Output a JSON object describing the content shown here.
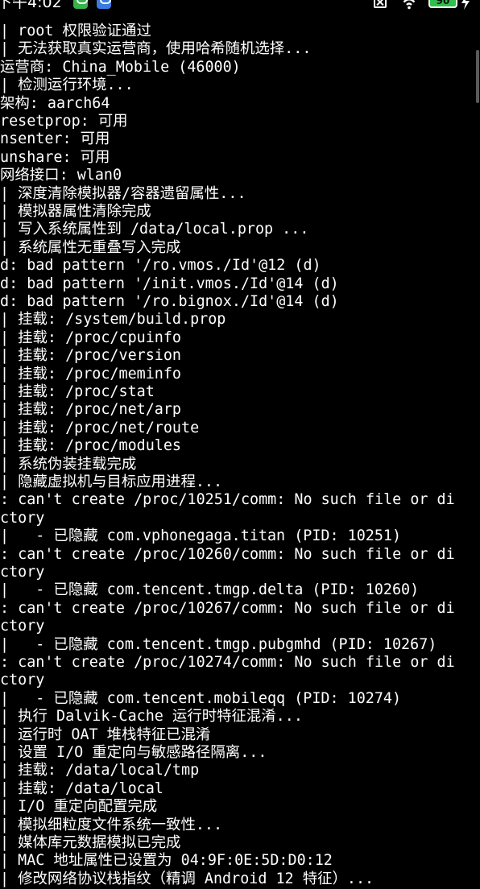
{
  "status_bar": {
    "time": "下午4:02",
    "battery_level": "90",
    "icons": [
      "app-notification-icon",
      "app-notification-icon",
      "sim-off-icon",
      "wifi-icon",
      "battery-icon",
      "charging-bolt-icon"
    ]
  },
  "terminal": {
    "lines": [
      "| root 权限验证通过",
      "| 无法获取真实运营商，使用哈希随机选择...",
      "运营商: China_Mobile (46000)",
      "| 检测运行环境...",
      "架构: aarch64",
      "resetprop: 可用",
      "nsenter: 可用",
      "unshare: 可用",
      "网络接口: wlan0",
      "| 深度清除模拟器/容器遗留属性...",
      "| 模拟器属性清除完成",
      "| 写入系统属性到 /data/local.prop ...",
      "| 系统属性无重叠写入完成",
      "d: bad pattern '/ro.vmos./Id'@12 (d)",
      "d: bad pattern '/init.vmos./Id'@14 (d)",
      "d: bad pattern '/ro.bignox./Id'@14 (d)",
      "| 挂载: /system/build.prop",
      "| 挂载: /proc/cpuinfo",
      "| 挂载: /proc/version",
      "| 挂载: /proc/meminfo",
      "| 挂载: /proc/stat",
      "| 挂载: /proc/net/arp",
      "| 挂载: /proc/net/route",
      "| 挂载: /proc/modules",
      "| 系统伪装挂载完成",
      "| 隐藏虚拟机与目标应用进程...",
      ": can't create /proc/10251/comm: No such file or di",
      "ctory",
      "|   - 已隐藏 com.vphonegaga.titan (PID: 10251)",
      ": can't create /proc/10260/comm: No such file or di",
      "ctory",
      "|   - 已隐藏 com.tencent.tmgp.delta (PID: 10260)",
      ": can't create /proc/10267/comm: No such file or di",
      "ctory",
      "|   - 已隐藏 com.tencent.tmgp.pubgmhd (PID: 10267)",
      ": can't create /proc/10274/comm: No such file or di",
      "ctory",
      "|   - 已隐藏 com.tencent.mobileqq (PID: 10274)",
      "| 执行 Dalvik-Cache 运行时特征混淆...",
      "| 运行时 OAT 堆栈特征已混淆",
      "| 设置 I/O 重定向与敏感路径隔离...",
      "| 挂载: /data/local/tmp",
      "| 挂载: /data/local",
      "| I/O 重定向配置完成",
      "| 模拟细粒度文件系统一致性...",
      "| 媒体库元数据模拟已完成",
      "| MAC 地址属性已设置为 04:9F:0E:5D:D0:12",
      "| 修改网络协议栈指纹（精调 Android 12 特征）..."
    ]
  }
}
